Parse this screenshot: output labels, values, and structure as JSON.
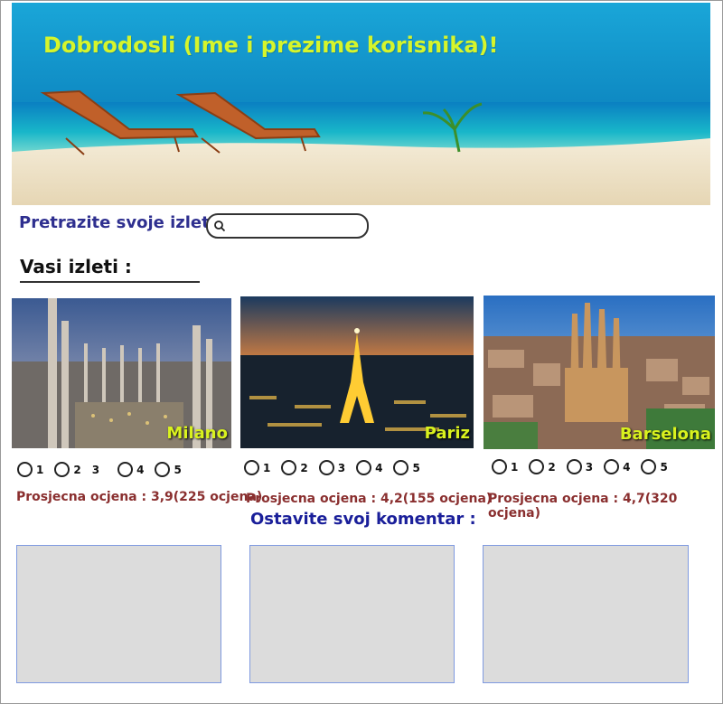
{
  "header": {
    "welcome_text": "Dobrodosli (Ime i prezime korisnika)!",
    "colors": {
      "welcome": "#d6f52b",
      "sea": "#0a9ad0",
      "sand": "#efe2c6"
    }
  },
  "search": {
    "label": "Pretrazite svoje izlete :",
    "value": "",
    "placeholder": ""
  },
  "trips": {
    "title": "Vasi izleti :",
    "rating_options": [
      "1",
      "2",
      "3",
      "4",
      "5"
    ],
    "items": [
      {
        "city": "Milano",
        "average": "Prosjecna ocjena : 3,9(225 ocjena)"
      },
      {
        "city": "Pariz",
        "average": "Prosjecna ocjena : 4,2(155 ocjena)"
      },
      {
        "city": "Barselona",
        "average": "Prosjecna ocjena : 4,7(320 ocjena)"
      }
    ]
  },
  "comments": {
    "title": "Ostavite svoj komentar :"
  }
}
